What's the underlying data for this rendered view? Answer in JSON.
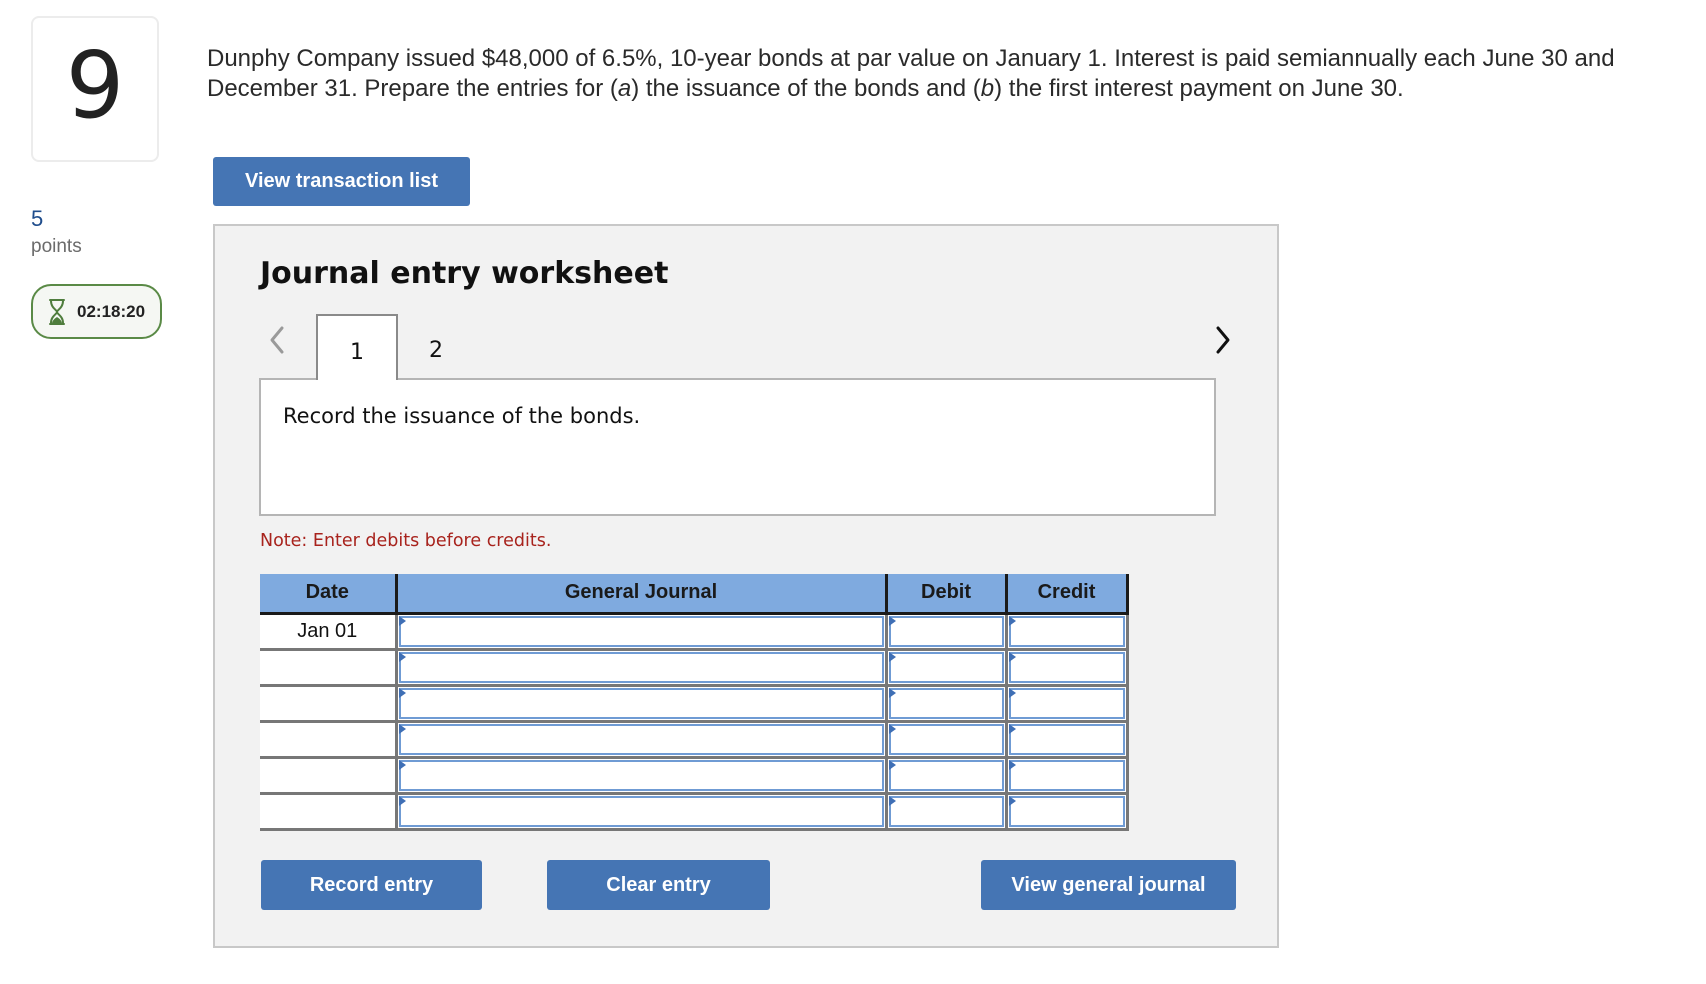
{
  "question": {
    "number": "9",
    "points_value": "5",
    "points_label": "points",
    "timer": "02:18:20",
    "text_parts": [
      {
        "t": "Dunphy Company issued $48,000 of 6.5%, 10-year bonds at par value on January 1. Interest is paid semiannually each June 30 and December 31. Prepare the entries for ("
      },
      {
        "t": "a",
        "italic": true
      },
      {
        "t": ") the issuance of the bonds and ("
      },
      {
        "t": "b",
        "italic": true
      },
      {
        "t": ") the first interest payment on June 30."
      }
    ]
  },
  "buttons": {
    "view_transaction_list": "View transaction list",
    "record_entry": "Record entry",
    "clear_entry": "Clear entry",
    "view_general_journal": "View general journal"
  },
  "worksheet": {
    "title": "Journal entry worksheet",
    "tabs": [
      {
        "label": "1",
        "active": true
      },
      {
        "label": "2",
        "active": false
      }
    ],
    "prev_icon": "chevron-left-icon",
    "next_icon": "chevron-right-icon",
    "instruction": "Record the issuance of the bonds.",
    "note": "Note: Enter debits before credits."
  },
  "journal": {
    "headers": {
      "date": "Date",
      "general_journal": "General Journal",
      "debit": "Debit",
      "credit": "Credit"
    },
    "rows": [
      {
        "date": "Jan 01",
        "account": "",
        "debit": "",
        "credit": ""
      },
      {
        "date": "",
        "account": "",
        "debit": "",
        "credit": ""
      },
      {
        "date": "",
        "account": "",
        "debit": "",
        "credit": ""
      },
      {
        "date": "",
        "account": "",
        "debit": "",
        "credit": ""
      },
      {
        "date": "",
        "account": "",
        "debit": "",
        "credit": ""
      },
      {
        "date": "",
        "account": "",
        "debit": "",
        "credit": ""
      }
    ]
  },
  "colors": {
    "button_blue": "#4575b4",
    "header_blue": "#7faadf",
    "note_red": "#a8231d",
    "timer_green": "#5a8a46",
    "points_blue": "#1f4d8c"
  }
}
